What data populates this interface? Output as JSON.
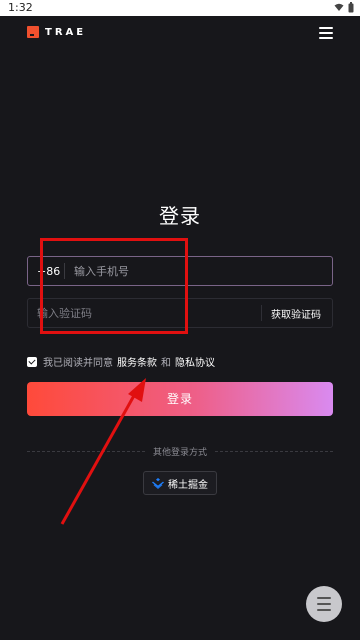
{
  "status_bar": {
    "time": "1:32"
  },
  "header": {
    "logo_text": "TRAE"
  },
  "login": {
    "title": "登录",
    "country_code": "+86",
    "phone_placeholder": "输入手机号",
    "code_placeholder": "输入验证码",
    "get_code_label": "获取验证码",
    "agree_prefix": "我已阅读并同意",
    "terms_link": "服务条款",
    "and_text": "和",
    "privacy_link": "隐私协议",
    "submit_label": "登录",
    "other_methods_label": "其他登录方式",
    "juejin_label": "稀土掘金"
  },
  "colors": {
    "background": "#17171b",
    "accent_start": "#ff4a3a",
    "accent_end": "#d98af0",
    "annotation": "#e11010"
  }
}
